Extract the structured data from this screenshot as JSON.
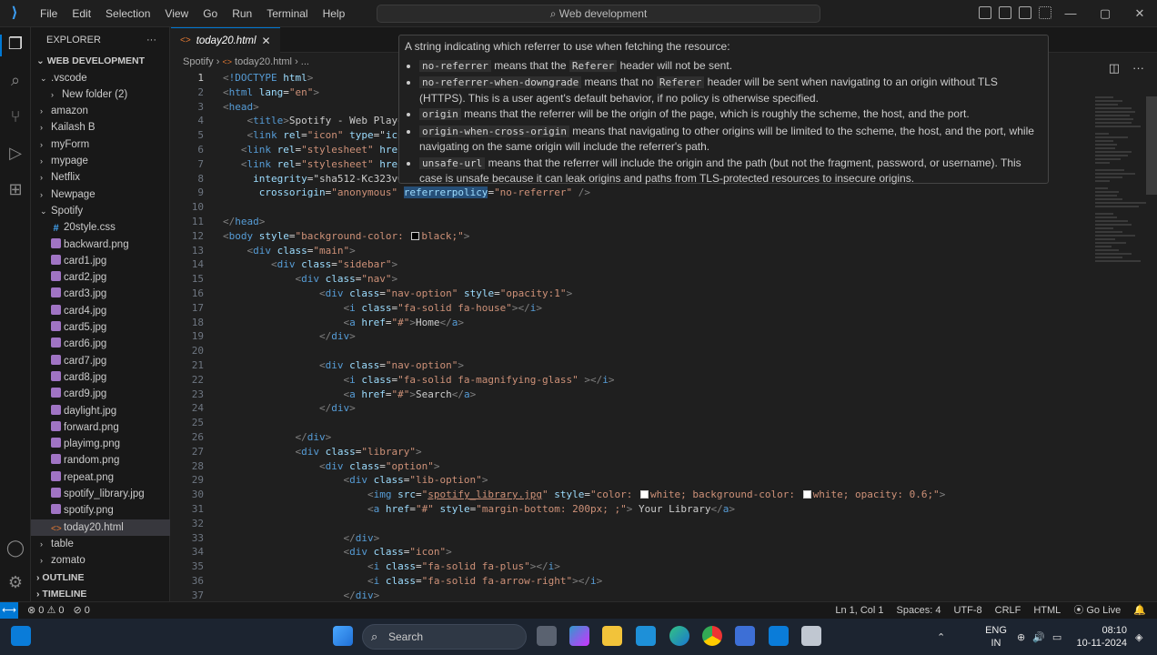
{
  "titlebar": {
    "menu": [
      "File",
      "Edit",
      "Selection",
      "View",
      "Go",
      "Run",
      "Terminal",
      "Help"
    ],
    "command_center": "Web development"
  },
  "sidebar": {
    "header": "EXPLORER",
    "root": "WEB DEVELOPMENT",
    "items": [
      {
        "label": ".vscode",
        "type": "folder",
        "open": true,
        "depth": 1
      },
      {
        "label": "New folder (2)",
        "type": "folder",
        "open": false,
        "depth": 2
      },
      {
        "label": "amazon",
        "type": "folder",
        "open": false,
        "depth": 1
      },
      {
        "label": "Kailash B",
        "type": "folder",
        "open": false,
        "depth": 1
      },
      {
        "label": "myForm",
        "type": "folder",
        "open": false,
        "depth": 1
      },
      {
        "label": "mypage",
        "type": "folder",
        "open": false,
        "depth": 1
      },
      {
        "label": "Netflix",
        "type": "folder",
        "open": false,
        "depth": 1
      },
      {
        "label": "Newpage",
        "type": "folder",
        "open": false,
        "depth": 1
      },
      {
        "label": "Spotify",
        "type": "folder",
        "open": true,
        "depth": 1
      },
      {
        "label": "20style.css",
        "type": "css",
        "depth": 2
      },
      {
        "label": "backward.png",
        "type": "img",
        "depth": 2
      },
      {
        "label": "card1.jpg",
        "type": "img",
        "depth": 2
      },
      {
        "label": "card2.jpg",
        "type": "img",
        "depth": 2
      },
      {
        "label": "card3.jpg",
        "type": "img",
        "depth": 2
      },
      {
        "label": "card4.jpg",
        "type": "img",
        "depth": 2
      },
      {
        "label": "card5.jpg",
        "type": "img",
        "depth": 2
      },
      {
        "label": "card6.jpg",
        "type": "img",
        "depth": 2
      },
      {
        "label": "card7.jpg",
        "type": "img",
        "depth": 2
      },
      {
        "label": "card8.jpg",
        "type": "img",
        "depth": 2
      },
      {
        "label": "card9.jpg",
        "type": "img",
        "depth": 2
      },
      {
        "label": "daylight.jpg",
        "type": "img",
        "depth": 2
      },
      {
        "label": "forward.png",
        "type": "img",
        "depth": 2
      },
      {
        "label": "playimg.png",
        "type": "img",
        "depth": 2
      },
      {
        "label": "random.png",
        "type": "img",
        "depth": 2
      },
      {
        "label": "repeat.png",
        "type": "img",
        "depth": 2
      },
      {
        "label": "spotify_library.jpg",
        "type": "img",
        "depth": 2
      },
      {
        "label": "spotify.png",
        "type": "img",
        "depth": 2
      },
      {
        "label": "today20.html",
        "type": "html",
        "depth": 2,
        "selected": true
      },
      {
        "label": "table",
        "type": "folder",
        "open": false,
        "depth": 1
      },
      {
        "label": "zomato",
        "type": "folder",
        "open": false,
        "depth": 1
      }
    ],
    "outline": "OUTLINE",
    "timeline": "TIMELINE"
  },
  "editor": {
    "tab": "today20.html",
    "breadcrumb": [
      "Spotify",
      "today20.html",
      "..."
    ],
    "lines": [
      "<!DOCTYPE html>",
      "<html lang=\"en\">",
      "<head>",
      "    <title>Spotify - Web Playe",
      "    <link rel=\"icon\" type=\"ico",
      "   <link rel=\"stylesheet\" href",
      "   <link rel=\"stylesheet\" href",
      "     integrity=\"sha512-Kc323vG",
      "      crossorigin=\"anonymous\" referrerpolicy=\"no-referrer\" />",
      "",
      "</head>",
      "<body style=\"background-color: black;\">",
      "    <div class=\"main\">",
      "        <div class=\"sidebar\">",
      "            <div class=\"nav\">",
      "                <div class=\"nav-option\" style=\"opacity:1\">",
      "                    <i class=\"fa-solid fa-house\"></i>",
      "                    <a href=\"#\">Home</a>",
      "                </div>",
      "",
      "                <div class=\"nav-option\">",
      "                    <i class=\"fa-solid fa-magnifying-glass\" ></i>",
      "                    <a href=\"#\">Search</a>",
      "                </div>",
      "",
      "            </div>",
      "            <div class=\"library\">",
      "                <div class=\"option\">",
      "                    <div class=\"lib-option\">",
      "                        <img src=\"spotify_library.jpg\" style=\"color: white; background-color: white; opacity: 0.6;\">",
      "                        <a href=\"#\" style=\"margin-bottom: 200px; ;\"> Your Library</a>",
      "",
      "                    </div>",
      "                    <div class=\"icon\">",
      "                        <i class=\"fa-solid fa-plus\"></i>",
      "                        <i class=\"fa-solid fa-arrow-right\"></i>",
      "                    </div>"
    ],
    "line_start": 1
  },
  "tooltip": {
    "intro": "A string indicating which referrer to use when fetching the resource:",
    "items": [
      {
        "code": "no-referrer",
        "pre": "",
        "text": " means that the ",
        "code2": "Referer",
        "text2": " header will not be sent."
      },
      {
        "code": "no-referrer-when-downgrade",
        "pre": "",
        "text": " means that no ",
        "code2": "Referer",
        "text2": " header will be sent when navigating to an origin without TLS (HTTPS). This is a user agent's default behavior, if no policy is otherwise specified."
      },
      {
        "code": "origin",
        "text": " means that the referrer will be the origin of the page, which is roughly the scheme, the host, and the port.",
        "code2": "",
        "text2": ""
      },
      {
        "code": "origin-when-cross-origin",
        "text": " means that navigating to other origins will be limited to the scheme, the host, and the port, while navigating on the same origin will include the referrer's path.",
        "code2": "",
        "text2": ""
      },
      {
        "code": "unsafe-url",
        "text": " means that the referrer will include the origin and the path (but not the fragment, password, or username). This case is unsafe because it can leak origins and paths from TLS-protected resources to insecure origins.",
        "code2": "",
        "text2": ""
      }
    ]
  },
  "statusbar": {
    "errors": "0",
    "warnings": "0",
    "ports": "0",
    "position": "Ln 1, Col 1",
    "spaces": "Spaces: 4",
    "encoding": "UTF-8",
    "eol": "CRLF",
    "language": "HTML",
    "golive": "Go Live"
  },
  "taskbar": {
    "search_placeholder": "Search",
    "lang1": "ENG",
    "lang2": "IN",
    "time": "08:10",
    "date": "10-11-2024"
  },
  "colors": {
    "accent": "#0078d4",
    "tag": "#569cd6",
    "attr": "#9cdcfe",
    "string": "#ce9178"
  }
}
